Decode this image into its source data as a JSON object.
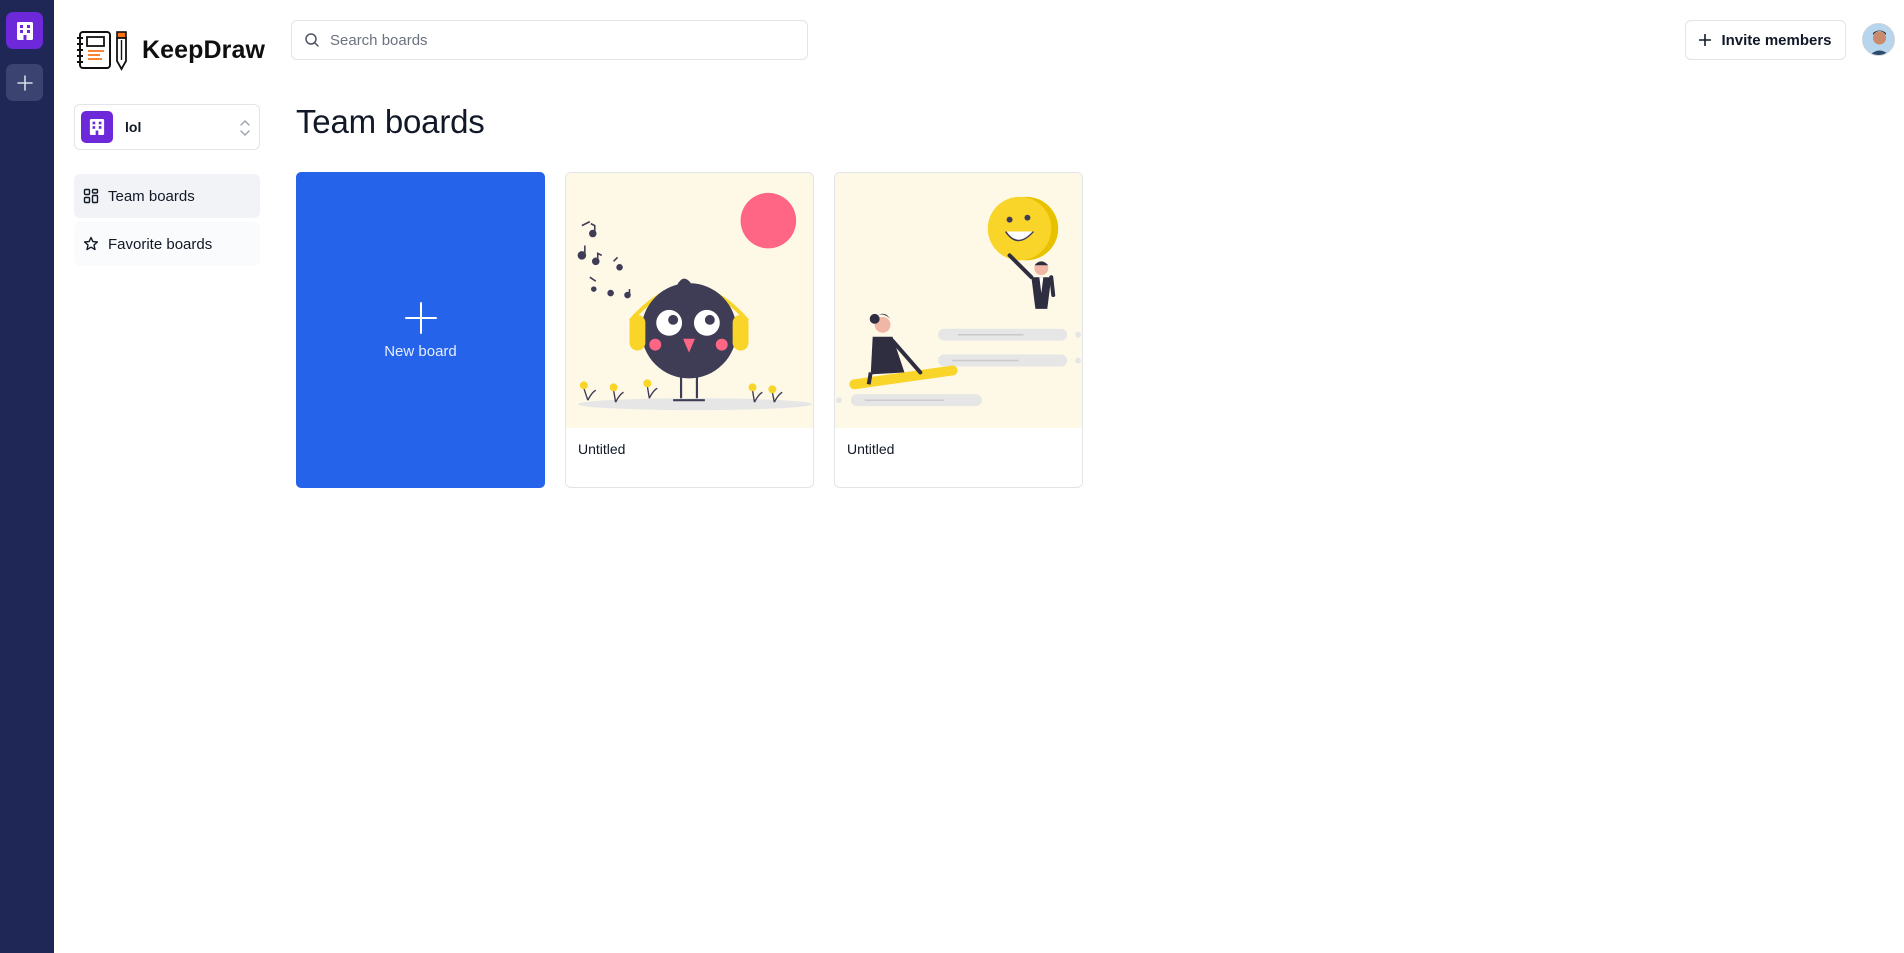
{
  "app": {
    "name": "KeepDraw"
  },
  "search": {
    "placeholder": "Search boards"
  },
  "header": {
    "invite_label": "Invite members"
  },
  "org": {
    "name": "lol"
  },
  "sidebar": {
    "items": [
      {
        "label": "Team boards",
        "icon": "grid-icon",
        "active": true
      },
      {
        "label": "Favorite boards",
        "icon": "star-icon",
        "active": false
      }
    ]
  },
  "main": {
    "title": "Team boards",
    "new_board_label": "New board",
    "boards": [
      {
        "title": "Untitled",
        "illustration": "bird-with-headphones"
      },
      {
        "title": "Untitled",
        "illustration": "people-with-smiley-balloon"
      }
    ]
  },
  "colors": {
    "rail_bg": "#1e2756",
    "org_accent": "#6d28d9",
    "primary": "#2563eb",
    "thumb_bg": "#fef9e7"
  }
}
